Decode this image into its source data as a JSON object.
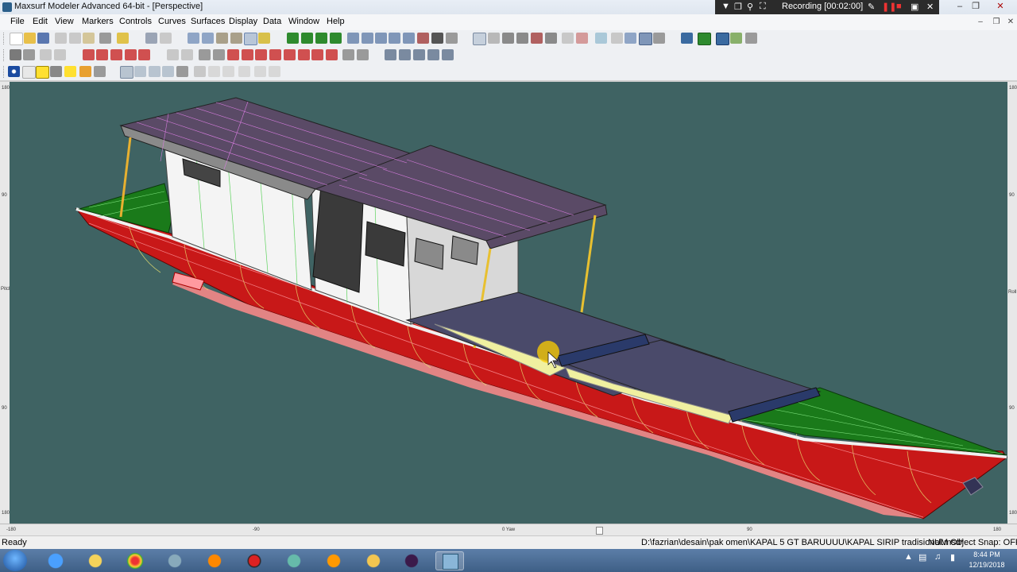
{
  "window": {
    "title": "Maxsurf Modeler Advanced 64-bit - [Perspective]",
    "recording_label": "Recording [00:02:00]"
  },
  "menu": [
    "File",
    "Edit",
    "View",
    "Markers",
    "Controls",
    "Curves",
    "Surfaces",
    "Display",
    "Data",
    "Window",
    "Help"
  ],
  "rulers": {
    "left": [
      "180",
      "90",
      "Pitch",
      "90",
      "180"
    ],
    "right": [
      "180",
      "90",
      "Roll",
      "90",
      "180"
    ],
    "bottom": [
      "-180",
      "-90",
      "0 Yaw",
      "90",
      "180"
    ]
  },
  "status": {
    "ready": "Ready",
    "file_path": "D:\\fazrian\\desain\\pak omen\\KAPAL 5 GT BARUUUU\\KAPAL SIRIP tradisional.msd*",
    "num": "NUM",
    "object_snap": "Object Snap: OFF"
  },
  "taskbar": {
    "time": "8:44 PM",
    "date": "12/19/2018",
    "apps": [
      "internet-explorer",
      "file-manager",
      "chrome",
      "app-installer",
      "firefox",
      "media-recorder",
      "autodesk",
      "media-player",
      "file-explorer",
      "premiere",
      "maxsurf"
    ]
  },
  "colors": {
    "viewport_bg": "#3f6363",
    "hull": "#c81818",
    "deck": "#1a7a1a",
    "roof": "#5a4a66",
    "cabin": "#f4f4f4",
    "ruler": "#e8e8e8"
  }
}
